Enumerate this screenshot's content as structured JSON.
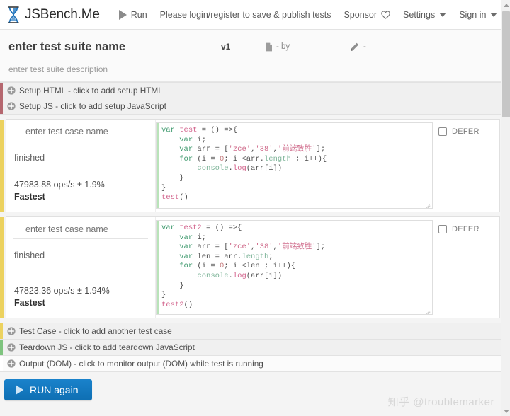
{
  "nav": {
    "brand": "JSBench.Me",
    "logo_icon": "hourglass-icon",
    "run_label": "Run",
    "run_icon": "play-triangle-icon",
    "login_notice": "Please login/register to save & publish tests",
    "sponsor_label": "Sponsor",
    "sponsor_icon": "heart-icon",
    "settings_label": "Settings",
    "settings_icon": "chevron-down-icon",
    "signin_label": "Sign in",
    "signin_icon": "chevron-down-icon"
  },
  "suite": {
    "name_placeholder": "enter test suite name",
    "description_placeholder": "enter test suite description",
    "version": "v1",
    "revision_icon": "document-icon",
    "author": "- by",
    "edit_icon": "pencil-icon",
    "edit_value": "-"
  },
  "setup_bars": [
    {
      "label": "Setup HTML - click to add setup HTML",
      "accent": "#b5676f",
      "icon": "plus-circle-icon",
      "name": "setup-html-bar"
    },
    {
      "label": "Setup JS - click to add setup JavaScript",
      "accent": "#b5676f",
      "icon": "plus-circle-icon",
      "name": "setup-js-bar"
    }
  ],
  "test_cases": [
    {
      "name_placeholder": "enter test case name",
      "status": "finished",
      "ops": "47983.88 ops/s ± 1.9%",
      "rank": "Fastest",
      "defer_label": "DEFER",
      "defer_checked": false,
      "accent": "#ecd25f",
      "code": "var test = () =>{\n    var i;\n    var arr = ['zce','38','前端致胜'];\n    for (i = 0; i <arr.length ; i++){\n        console.log(arr[i])\n    }\n}\ntest()"
    },
    {
      "name_placeholder": "enter test case name",
      "status": "finished",
      "ops": "47823.36 ops/s ± 1.94%",
      "rank": "Fastest",
      "defer_label": "DEFER",
      "defer_checked": false,
      "accent": "#ecd25f",
      "code": "var test2 = () =>{\n    var i;\n    var arr = ['zce','38','前端致胜'];\n    var len = arr.length;\n    for (i = 0; i <len ; i++){\n        console.log(arr[i])\n    }\n}\ntest2()"
    }
  ],
  "bottom_bars": [
    {
      "label": "Test Case - click to add another test case",
      "accent": "#ecd25f",
      "icon": "plus-circle-icon",
      "name": "add-test-case-bar"
    },
    {
      "label": "Teardown JS - click to add teardown JavaScript",
      "accent": "#7fc47f",
      "icon": "plus-circle-icon",
      "name": "teardown-js-bar"
    },
    {
      "label": "Output (DOM) - click to monitor output (DOM) while test is running",
      "accent": "#ffffff",
      "icon": "plus-circle-icon",
      "name": "output-dom-bar"
    }
  ],
  "run_button": {
    "label": "RUN again",
    "icon": "play-triangle-icon",
    "color": "#1478bf"
  },
  "watermark": "知乎 @troublemarker"
}
